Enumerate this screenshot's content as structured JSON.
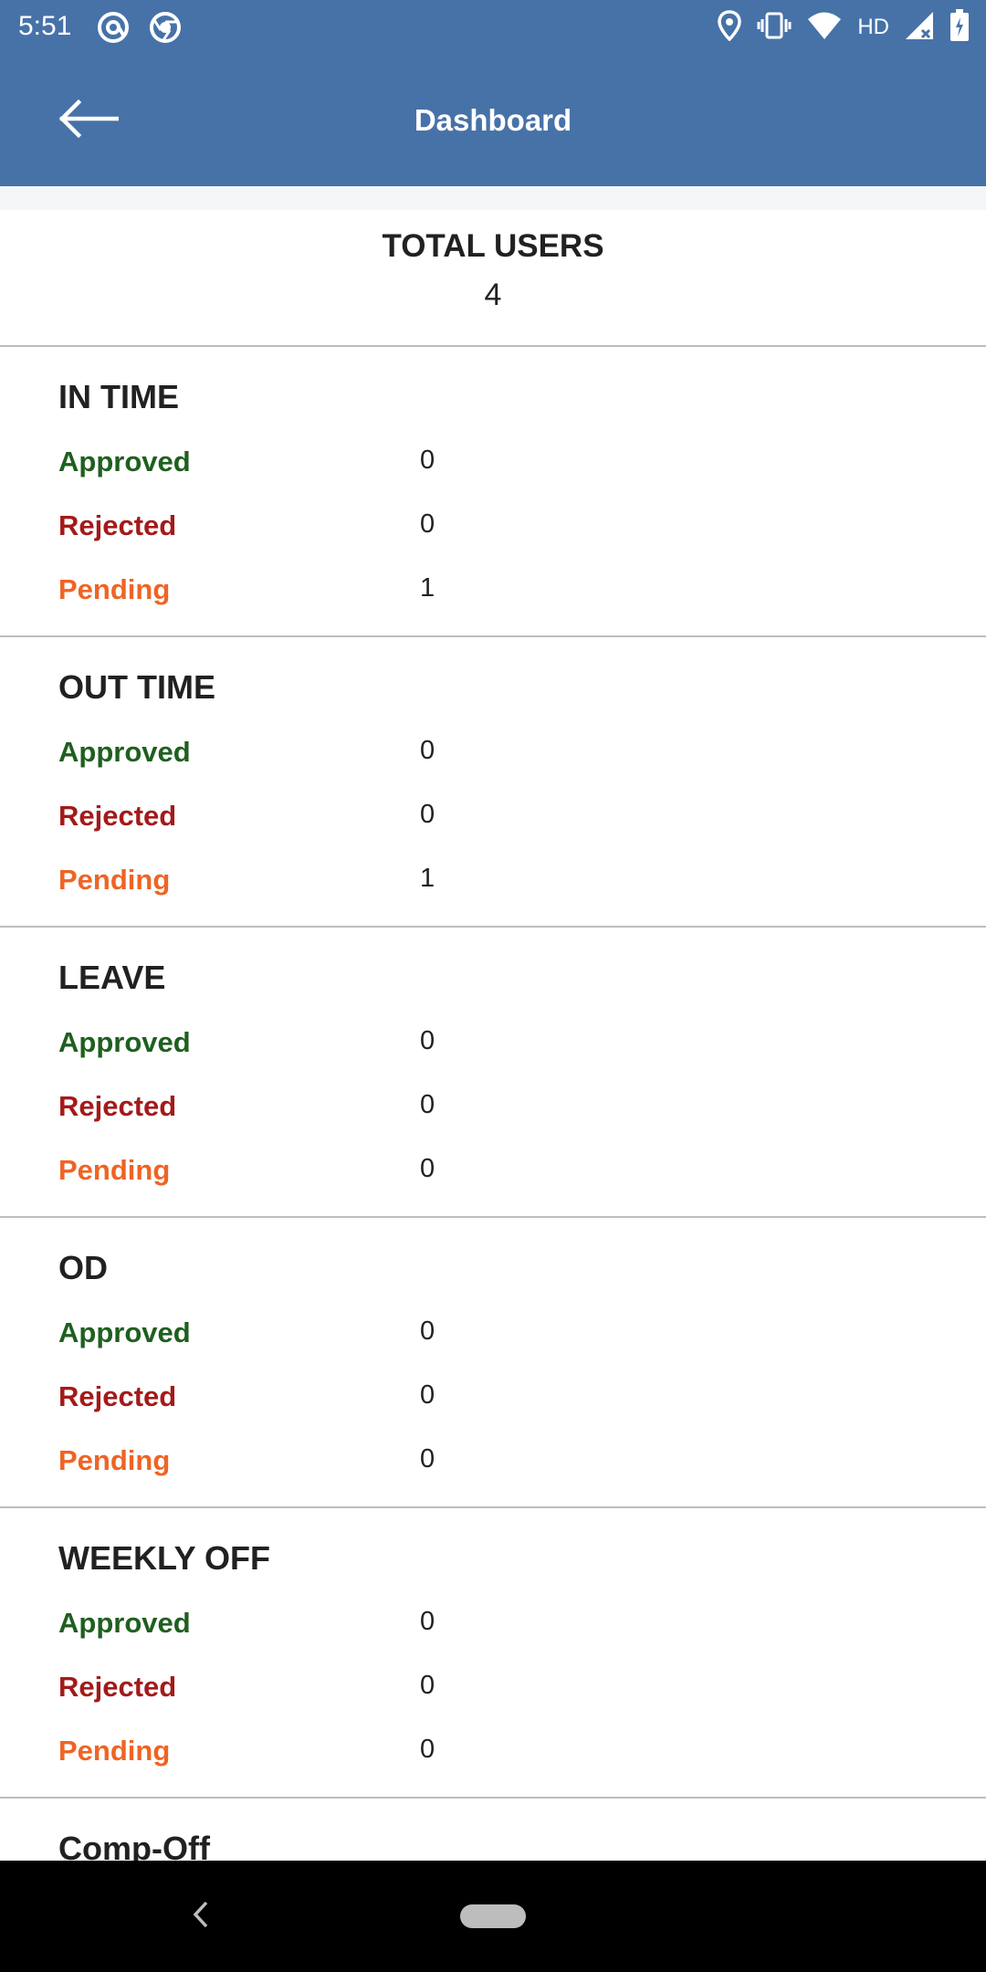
{
  "status_bar": {
    "time": "5:51",
    "network_label": "HD",
    "icons": [
      "at-sign-icon",
      "chrome-icon",
      "location-icon",
      "vibrate-icon",
      "wifi-icon",
      "signal-icon",
      "battery-icon"
    ]
  },
  "app_bar": {
    "title": "Dashboard",
    "back_icon": "arrow-back-icon",
    "background": "#4772a8"
  },
  "total_users": {
    "label": "TOTAL USERS",
    "value": "4"
  },
  "sections": [
    {
      "title": "IN TIME",
      "approved_label": "Approved",
      "approved": "0",
      "rejected_label": "Rejected",
      "rejected": "0",
      "pending_label": "Pending",
      "pending": "1"
    },
    {
      "title": "OUT TIME",
      "approved_label": "Approved",
      "approved": "0",
      "rejected_label": "Rejected",
      "rejected": "0",
      "pending_label": "Pending",
      "pending": "1"
    },
    {
      "title": "LEAVE",
      "approved_label": "Approved",
      "approved": "0",
      "rejected_label": "Rejected",
      "rejected": "0",
      "pending_label": "Pending",
      "pending": "0"
    },
    {
      "title": "OD",
      "approved_label": "Approved",
      "approved": "0",
      "rejected_label": "Rejected",
      "rejected": "0",
      "pending_label": "Pending",
      "pending": "0"
    },
    {
      "title": "WEEKLY OFF",
      "approved_label": "Approved",
      "approved": "0",
      "rejected_label": "Rejected",
      "rejected": "0",
      "pending_label": "Pending",
      "pending": "0"
    }
  ],
  "partial_section_title": "Comp-Off",
  "colors": {
    "approved": "#1f5f1f",
    "rejected": "#a31a1a",
    "pending": "#ef6424"
  },
  "nav_bar": {
    "icons": [
      "nav-back-icon",
      "home-pill-icon"
    ]
  }
}
